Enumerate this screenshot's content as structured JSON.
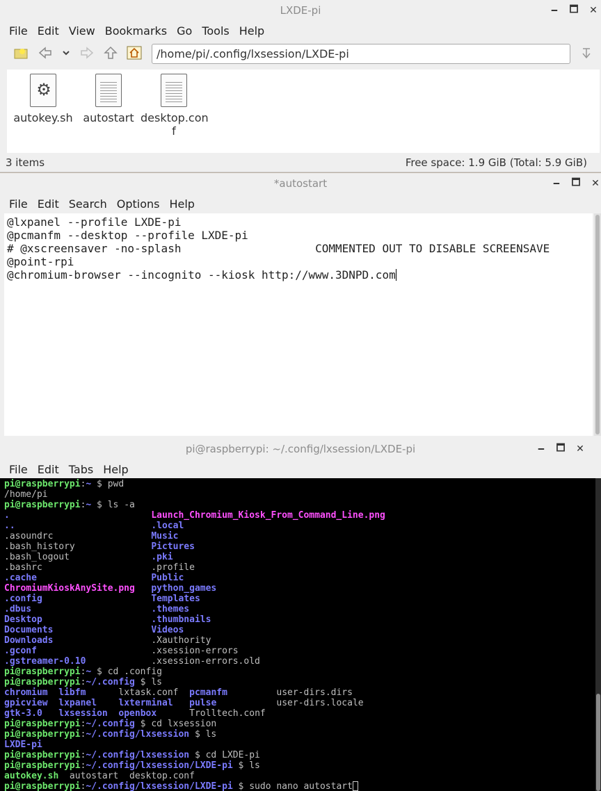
{
  "file_manager": {
    "title": "LXDE-pi",
    "menu": [
      "File",
      "Edit",
      "View",
      "Bookmarks",
      "Go",
      "Tools",
      "Help"
    ],
    "path": "/home/pi/.config/lxsession/LXDE-pi",
    "files": [
      {
        "name": "autokey.sh",
        "icon": "script-gear-icon"
      },
      {
        "name": "autostart",
        "icon": "text-document-icon"
      },
      {
        "name": "desktop.conf",
        "icon": "text-document-icon",
        "name_line1": "desktop.con",
        "name_line2": "f"
      }
    ],
    "status_left": "3 items",
    "status_right": "Free space: 1.9 GiB (Total: 5.9 GiB)"
  },
  "editor": {
    "title": "*autostart",
    "menu": [
      "File",
      "Edit",
      "Search",
      "Options",
      "Help"
    ],
    "lines": [
      "@lxpanel --profile LXDE-pi",
      "@pcmanfm --desktop --profile LXDE-pi",
      "# @xscreensaver -no-splash                    COMMENTED OUT TO DISABLE SCREENSAVE",
      "@point-rpi",
      "@chromium-browser --incognito --kiosk http://www.3DNPD.com"
    ]
  },
  "terminal": {
    "title": "pi@raspberrypi: ~/.config/lxsession/LXDE-pi",
    "menu": [
      "File",
      "Edit",
      "Tabs",
      "Help"
    ],
    "lines": [
      [
        {
          "t": "pi@raspberrypi",
          "c": "prompt"
        },
        {
          "t": ":",
          "c": "norm"
        },
        {
          "t": "~",
          "c": "path"
        },
        {
          "t": " $ pwd",
          "c": "norm"
        }
      ],
      [
        {
          "t": "/home/pi",
          "c": "norm"
        }
      ],
      [
        {
          "t": "pi@raspberrypi",
          "c": "prompt"
        },
        {
          "t": ":",
          "c": "norm"
        },
        {
          "t": "~",
          "c": "path"
        },
        {
          "t": " $ ls -a",
          "c": "norm"
        }
      ],
      [
        {
          "t": ".                          ",
          "c": "dir"
        },
        {
          "t": "Launch_Chromium_Kiosk_From_Command_Line.png",
          "c": "img"
        }
      ],
      [
        {
          "t": "..                         ",
          "c": "dir"
        },
        {
          "t": ".local",
          "c": "dir"
        }
      ],
      [
        {
          "t": ".asoundrc                  ",
          "c": "norm"
        },
        {
          "t": "Music",
          "c": "dir"
        }
      ],
      [
        {
          "t": ".bash_history              ",
          "c": "norm"
        },
        {
          "t": "Pictures",
          "c": "dir"
        }
      ],
      [
        {
          "t": ".bash_logout               ",
          "c": "norm"
        },
        {
          "t": ".pki",
          "c": "dir"
        }
      ],
      [
        {
          "t": ".bashrc                    ",
          "c": "norm"
        },
        {
          "t": ".profile",
          "c": "norm"
        }
      ],
      [
        {
          "t": ".cache                     ",
          "c": "dir"
        },
        {
          "t": "Public",
          "c": "dir"
        }
      ],
      [
        {
          "t": "ChromiumKioskAnySite.png",
          "c": "img"
        },
        {
          "t": "   ",
          "c": "norm"
        },
        {
          "t": "python_games",
          "c": "dir"
        }
      ],
      [
        {
          "t": ".config                    ",
          "c": "dir"
        },
        {
          "t": "Templates",
          "c": "dir"
        }
      ],
      [
        {
          "t": ".dbus                      ",
          "c": "dir"
        },
        {
          "t": ".themes",
          "c": "dir"
        }
      ],
      [
        {
          "t": "Desktop                    ",
          "c": "dir"
        },
        {
          "t": ".thumbnails",
          "c": "dir"
        }
      ],
      [
        {
          "t": "Documents                  ",
          "c": "dir"
        },
        {
          "t": "Videos",
          "c": "dir"
        }
      ],
      [
        {
          "t": "Downloads                  ",
          "c": "dir"
        },
        {
          "t": ".Xauthority",
          "c": "norm"
        }
      ],
      [
        {
          "t": ".gconf                     ",
          "c": "dir"
        },
        {
          "t": ".xsession-errors",
          "c": "norm"
        }
      ],
      [
        {
          "t": ".gstreamer-0.10            ",
          "c": "dir"
        },
        {
          "t": ".xsession-errors.old",
          "c": "norm"
        }
      ],
      [
        {
          "t": "pi@raspberrypi",
          "c": "prompt"
        },
        {
          "t": ":",
          "c": "norm"
        },
        {
          "t": "~",
          "c": "path"
        },
        {
          "t": " $ cd .config",
          "c": "norm"
        }
      ],
      [
        {
          "t": "pi@raspberrypi",
          "c": "prompt"
        },
        {
          "t": ":",
          "c": "norm"
        },
        {
          "t": "~/.config",
          "c": "path"
        },
        {
          "t": " $ ls",
          "c": "norm"
        }
      ],
      [
        {
          "t": "chromium",
          "c": "dir"
        },
        {
          "t": "  ",
          "c": "norm"
        },
        {
          "t": "libfm",
          "c": "dir"
        },
        {
          "t": "      lxtask.conf  ",
          "c": "norm"
        },
        {
          "t": "pcmanfm",
          "c": "dir"
        },
        {
          "t": "         user-dirs.dirs",
          "c": "norm"
        }
      ],
      [
        {
          "t": "gpicview",
          "c": "dir"
        },
        {
          "t": "  ",
          "c": "norm"
        },
        {
          "t": "lxpanel",
          "c": "dir"
        },
        {
          "t": "    ",
          "c": "norm"
        },
        {
          "t": "lxterminal",
          "c": "dir"
        },
        {
          "t": "   ",
          "c": "norm"
        },
        {
          "t": "pulse",
          "c": "dir"
        },
        {
          "t": "           user-dirs.locale",
          "c": "norm"
        }
      ],
      [
        {
          "t": "gtk-3.0",
          "c": "dir"
        },
        {
          "t": "   ",
          "c": "norm"
        },
        {
          "t": "lxsession",
          "c": "dir"
        },
        {
          "t": "  ",
          "c": "norm"
        },
        {
          "t": "openbox",
          "c": "dir"
        },
        {
          "t": "      Trolltech.conf",
          "c": "norm"
        }
      ],
      [
        {
          "t": "pi@raspberrypi",
          "c": "prompt"
        },
        {
          "t": ":",
          "c": "norm"
        },
        {
          "t": "~/.config",
          "c": "path"
        },
        {
          "t": " $ cd lxsession",
          "c": "norm"
        }
      ],
      [
        {
          "t": "pi@raspberrypi",
          "c": "prompt"
        },
        {
          "t": ":",
          "c": "norm"
        },
        {
          "t": "~/.config/lxsession",
          "c": "path"
        },
        {
          "t": " $ ls",
          "c": "norm"
        }
      ],
      [
        {
          "t": "LXDE-pi",
          "c": "dir"
        }
      ],
      [
        {
          "t": "pi@raspberrypi",
          "c": "prompt"
        },
        {
          "t": ":",
          "c": "norm"
        },
        {
          "t": "~/.config/lxsession",
          "c": "path"
        },
        {
          "t": " $ cd LXDE-pi",
          "c": "norm"
        }
      ],
      [
        {
          "t": "pi@raspberrypi",
          "c": "prompt"
        },
        {
          "t": ":",
          "c": "norm"
        },
        {
          "t": "~/.config/lxsession/LXDE-pi",
          "c": "path"
        },
        {
          "t": " $ ls",
          "c": "norm"
        }
      ],
      [
        {
          "t": "autokey.sh",
          "c": "exe"
        },
        {
          "t": "  autostart  desktop.conf",
          "c": "norm"
        }
      ],
      [
        {
          "t": "pi@raspberrypi",
          "c": "prompt"
        },
        {
          "t": ":",
          "c": "norm"
        },
        {
          "t": "~/.config/lxsession/LXDE-pi",
          "c": "path"
        },
        {
          "t": " $ sudo nano autostart",
          "c": "norm"
        }
      ]
    ]
  },
  "window_controls": {
    "minimize": "🗕",
    "maximize": "🗖",
    "close": "✕"
  }
}
